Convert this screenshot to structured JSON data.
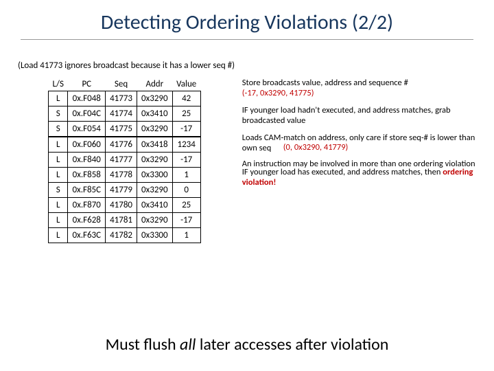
{
  "title": "Detecting Ordering Violations (2/2)",
  "note": "(Load 41773 ignores  broadcast because it has a lower seq #)",
  "table": {
    "headers": {
      "ls": "L/S",
      "pc": "PC",
      "seq": "Seq",
      "addr": "Addr",
      "value": "Value"
    },
    "rows": [
      {
        "ls": "L",
        "pc": "0x.F048",
        "seq": "41773",
        "addr": "0x3290",
        "value": "42"
      },
      {
        "ls": "S",
        "pc": "0x.F04C",
        "seq": "41774",
        "addr": "0x3410",
        "value": "25"
      },
      {
        "ls": "S",
        "pc": "0x.F054",
        "seq": "41775",
        "addr": "0x3290",
        "value": "-17"
      },
      {
        "ls": "L",
        "pc": "0x.F060",
        "seq": "41776",
        "addr": "0x3418",
        "value": "1234"
      },
      {
        "ls": "L",
        "pc": "0x.F840",
        "seq": "41777",
        "addr": "0x3290",
        "value": "-17"
      },
      {
        "ls": "L",
        "pc": "0x.F858",
        "seq": "41778",
        "addr": "0x3300",
        "value": "1"
      },
      {
        "ls": "S",
        "pc": "0x.F85C",
        "seq": "41779",
        "addr": "0x3290",
        "value": "0"
      },
      {
        "ls": "L",
        "pc": "0x.F870",
        "seq": "41780",
        "addr": "0x3410",
        "value": "25"
      },
      {
        "ls": "L",
        "pc": "0x.F628",
        "seq": "41781",
        "addr": "0x3290",
        "value": "-17"
      },
      {
        "ls": "L",
        "pc": "0x.F63C",
        "seq": "41782",
        "addr": "0x3300",
        "value": "1"
      }
    ]
  },
  "annot": {
    "a1": "Store broadcasts value, address and sequence #",
    "a2_red": "(-17, 0x3290, 41775)",
    "a3": "IF younger load hadn't executed, and address matches, grab broadcasted value",
    "a4a": "Loads CAM-match on address, only care if store seq-# is lower than own seq",
    "a4b_red": "(0, 0x3290, 41779)",
    "a5a": "An instruction may be involved in more than one ordering violation",
    "a5b": "IF younger load has executed, and address matches, then ",
    "a5c_red": "ordering violation!"
  },
  "conclusion_a": "Must flush ",
  "conclusion_b": "all",
  "conclusion_c": " later accesses after violation"
}
